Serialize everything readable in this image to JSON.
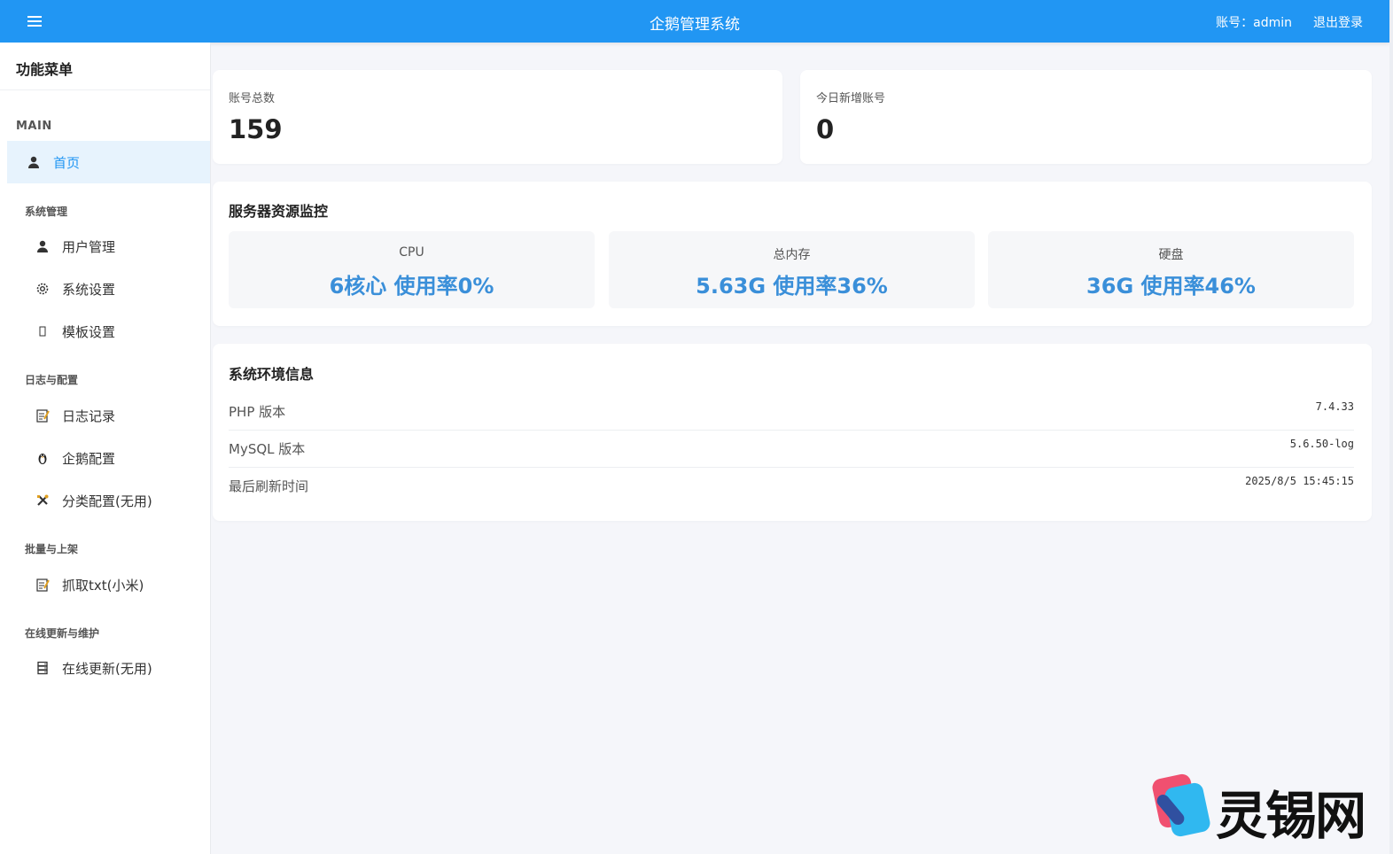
{
  "topbar": {
    "menu_icon": "hamburger-icon",
    "title": "企鹅管理系统",
    "account": "账号：admin",
    "logout": "退出登录"
  },
  "sidebar": {
    "header": "功能菜单",
    "main_label": "MAIN",
    "home": {
      "label": "首页",
      "icon": "user-icon"
    },
    "groups": [
      {
        "label": "系统管理",
        "items": [
          {
            "label": "用户管理",
            "icon": "user-icon"
          },
          {
            "label": "系统设置",
            "icon": "gear-icon"
          },
          {
            "label": "模板设置",
            "icon": "template-icon"
          }
        ]
      },
      {
        "label": "日志与配置",
        "items": [
          {
            "label": "日志记录",
            "icon": "memo-icon"
          },
          {
            "label": "企鹅配置",
            "icon": "penguin-icon"
          },
          {
            "label": "分类配置(无用)",
            "icon": "tools-icon"
          }
        ]
      },
      {
        "label": "批量与上架",
        "items": [
          {
            "label": "抓取txt(小米)",
            "icon": "memo-icon"
          }
        ]
      },
      {
        "label": "在线更新与维护",
        "items": [
          {
            "label": "在线更新(无用)",
            "icon": "server-icon"
          }
        ]
      }
    ]
  },
  "stats": {
    "total_label": "账号总数",
    "total_value": "159",
    "today_label": "今日新增账号",
    "today_value": "0"
  },
  "monitor": {
    "title": "服务器资源监控",
    "cpu_label": "CPU",
    "cpu_value": "6核心 使用率0%",
    "mem_label": "总内存",
    "mem_value": "5.63G 使用率36%",
    "disk_label": "硬盘",
    "disk_value": "36G 使用率46%"
  },
  "env": {
    "title": "系统环境信息",
    "rows": [
      {
        "key": "PHP 版本",
        "value": "7.4.33"
      },
      {
        "key": "MySQL 版本",
        "value": "5.6.50-log"
      },
      {
        "key": "最后刷新时间",
        "value": "2025/8/5 15:45:15"
      }
    ]
  },
  "watermark": {
    "text": "灵锡网"
  },
  "colors": {
    "accent": "#2196f3",
    "value_blue": "#3a8fd9"
  }
}
